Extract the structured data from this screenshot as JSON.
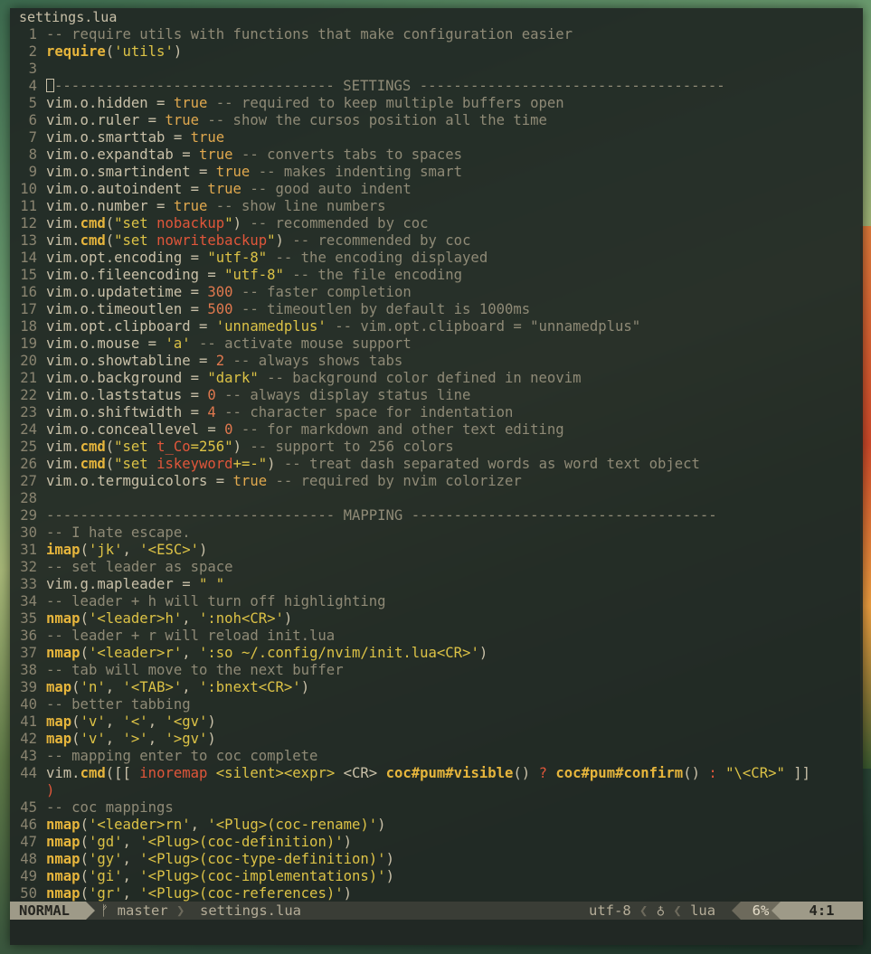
{
  "title": "settings.lua",
  "lines": [
    {
      "n": "1",
      "t": [
        [
          "c",
          "-- require utils with functions that make configuration easier"
        ]
      ]
    },
    {
      "n": "2",
      "t": [
        [
          "kw",
          "require"
        ],
        [
          "op",
          "("
        ],
        [
          "str",
          "'utils'"
        ],
        [
          "op",
          ")"
        ]
      ]
    },
    {
      "n": "3",
      "t": []
    },
    {
      "n": "4",
      "cursor": true,
      "t": [
        [
          "c",
          "---------------------------------- SETTINGS ------------------------------------"
        ]
      ]
    },
    {
      "n": "5",
      "t": [
        [
          "op",
          "vim.o.hidden = "
        ],
        [
          "bool",
          "true"
        ],
        [
          "c",
          " -- required to keep multiple buffers open"
        ]
      ]
    },
    {
      "n": "6",
      "t": [
        [
          "op",
          "vim.o.ruler = "
        ],
        [
          "bool",
          "true"
        ],
        [
          "c",
          " -- show the cursos position all the time"
        ]
      ]
    },
    {
      "n": "7",
      "t": [
        [
          "op",
          "vim.o.smarttab = "
        ],
        [
          "bool",
          "true"
        ]
      ]
    },
    {
      "n": "8",
      "t": [
        [
          "op",
          "vim.o.expandtab = "
        ],
        [
          "bool",
          "true"
        ],
        [
          "c",
          " -- converts tabs to spaces"
        ]
      ]
    },
    {
      "n": "9",
      "t": [
        [
          "op",
          "vim.o.smartindent = "
        ],
        [
          "bool",
          "true"
        ],
        [
          "c",
          " -- makes indenting smart"
        ]
      ]
    },
    {
      "n": "10",
      "t": [
        [
          "op",
          "vim.o.autoindent = "
        ],
        [
          "bool",
          "true"
        ],
        [
          "c",
          " -- good auto indent"
        ]
      ]
    },
    {
      "n": "11",
      "t": [
        [
          "op",
          "vim.o.number = "
        ],
        [
          "bool",
          "true"
        ],
        [
          "c",
          " -- show line numbers"
        ]
      ]
    },
    {
      "n": "12",
      "t": [
        [
          "op",
          "vim."
        ],
        [
          "kw",
          "cmd"
        ],
        [
          "op",
          "("
        ],
        [
          "str",
          "\"set "
        ],
        [
          "red",
          "nobackup"
        ],
        [
          "str",
          "\""
        ],
        [
          "op",
          ")"
        ],
        [
          "c",
          " -- recommended by coc"
        ]
      ]
    },
    {
      "n": "13",
      "t": [
        [
          "op",
          "vim."
        ],
        [
          "kw",
          "cmd"
        ],
        [
          "op",
          "("
        ],
        [
          "str",
          "\"set "
        ],
        [
          "red",
          "nowritebackup"
        ],
        [
          "str",
          "\""
        ],
        [
          "op",
          ")"
        ],
        [
          "c",
          " -- recommended by coc"
        ]
      ]
    },
    {
      "n": "14",
      "t": [
        [
          "op",
          "vim.opt.encoding = "
        ],
        [
          "str",
          "\"utf-8\""
        ],
        [
          "c",
          " -- the encoding displayed"
        ]
      ]
    },
    {
      "n": "15",
      "t": [
        [
          "op",
          "vim.o.fileencoding = "
        ],
        [
          "str",
          "\"utf-8\""
        ],
        [
          "c",
          " -- the file encoding"
        ]
      ]
    },
    {
      "n": "16",
      "t": [
        [
          "op",
          "vim.o.updatetime = "
        ],
        [
          "num",
          "300"
        ],
        [
          "c",
          " -- faster completion"
        ]
      ]
    },
    {
      "n": "17",
      "t": [
        [
          "op",
          "vim.o.timeoutlen = "
        ],
        [
          "num",
          "500"
        ],
        [
          "c",
          " -- timeoutlen by default is 1000ms"
        ]
      ]
    },
    {
      "n": "18",
      "t": [
        [
          "op",
          "vim.opt.clipboard = "
        ],
        [
          "str",
          "'unnamedplus'"
        ],
        [
          "c",
          " -- vim.opt.clipboard = \"unnamedplus\""
        ]
      ]
    },
    {
      "n": "19",
      "t": [
        [
          "op",
          "vim.o.mouse = "
        ],
        [
          "str",
          "'a'"
        ],
        [
          "c",
          " -- activate mouse support"
        ]
      ]
    },
    {
      "n": "20",
      "t": [
        [
          "op",
          "vim.o.showtabline = "
        ],
        [
          "num",
          "2"
        ],
        [
          "c",
          " -- always shows tabs"
        ]
      ]
    },
    {
      "n": "21",
      "t": [
        [
          "op",
          "vim.o.background = "
        ],
        [
          "str",
          "\"dark\""
        ],
        [
          "c",
          " -- background color defined in neovim"
        ]
      ]
    },
    {
      "n": "22",
      "t": [
        [
          "op",
          "vim.o.laststatus = "
        ],
        [
          "num",
          "0"
        ],
        [
          "c",
          " -- always display status line"
        ]
      ]
    },
    {
      "n": "23",
      "t": [
        [
          "op",
          "vim.o.shiftwidth = "
        ],
        [
          "num",
          "4"
        ],
        [
          "c",
          " -- character space for indentation"
        ]
      ]
    },
    {
      "n": "24",
      "t": [
        [
          "op",
          "vim.o.conceallevel = "
        ],
        [
          "num",
          "0"
        ],
        [
          "c",
          " -- for markdown and other text editing"
        ]
      ]
    },
    {
      "n": "25",
      "t": [
        [
          "op",
          "vim."
        ],
        [
          "kw",
          "cmd"
        ],
        [
          "op",
          "("
        ],
        [
          "str",
          "\"set "
        ],
        [
          "red",
          "t_Co"
        ],
        [
          "str",
          "=256\""
        ],
        [
          "op",
          ")"
        ],
        [
          "c",
          " -- support to 256 colors"
        ]
      ]
    },
    {
      "n": "26",
      "t": [
        [
          "op",
          "vim."
        ],
        [
          "kw",
          "cmd"
        ],
        [
          "op",
          "("
        ],
        [
          "str",
          "\"set "
        ],
        [
          "red",
          "iskeyword"
        ],
        [
          "str",
          "+=-\""
        ],
        [
          "op",
          ")"
        ],
        [
          "c",
          " -- treat dash separated words as word text object"
        ]
      ]
    },
    {
      "n": "27",
      "t": [
        [
          "op",
          "vim.o.termguicolors = "
        ],
        [
          "bool",
          "true"
        ],
        [
          "c",
          " -- required by nvim colorizer"
        ]
      ]
    },
    {
      "n": "28",
      "t": []
    },
    {
      "n": "29",
      "t": [
        [
          "c",
          "---------------------------------- MAPPING ------------------------------------"
        ]
      ]
    },
    {
      "n": "30",
      "t": [
        [
          "c",
          "-- I hate escape."
        ]
      ]
    },
    {
      "n": "31",
      "t": [
        [
          "kw",
          "imap"
        ],
        [
          "op",
          "("
        ],
        [
          "str",
          "'jk'"
        ],
        [
          "op",
          ", "
        ],
        [
          "str",
          "'<ESC>'"
        ],
        [
          "op",
          ")"
        ]
      ]
    },
    {
      "n": "32",
      "t": [
        [
          "c",
          "-- set leader as space"
        ]
      ]
    },
    {
      "n": "33",
      "t": [
        [
          "op",
          "vim.g.mapleader = "
        ],
        [
          "str",
          "\" \""
        ]
      ]
    },
    {
      "n": "34",
      "t": [
        [
          "c",
          "-- leader + h will turn off highlighting"
        ]
      ]
    },
    {
      "n": "35",
      "t": [
        [
          "kw",
          "nmap"
        ],
        [
          "op",
          "("
        ],
        [
          "str",
          "'<leader>h'"
        ],
        [
          "op",
          ", "
        ],
        [
          "str",
          "':noh<CR>'"
        ],
        [
          "op",
          ")"
        ]
      ]
    },
    {
      "n": "36",
      "t": [
        [
          "c",
          "-- leader + r will reload init.lua"
        ]
      ]
    },
    {
      "n": "37",
      "t": [
        [
          "kw",
          "nmap"
        ],
        [
          "op",
          "("
        ],
        [
          "str",
          "'<leader>r'"
        ],
        [
          "op",
          ", "
        ],
        [
          "str",
          "':so ~/.config/nvim/init.lua<CR>'"
        ],
        [
          "op",
          ")"
        ]
      ]
    },
    {
      "n": "38",
      "t": [
        [
          "c",
          "-- tab will move to the next buffer"
        ]
      ]
    },
    {
      "n": "39",
      "t": [
        [
          "kw",
          "map"
        ],
        [
          "op",
          "("
        ],
        [
          "str",
          "'n'"
        ],
        [
          "op",
          ", "
        ],
        [
          "str",
          "'<TAB>'"
        ],
        [
          "op",
          ", "
        ],
        [
          "str",
          "':bnext<CR>'"
        ],
        [
          "op",
          ")"
        ]
      ]
    },
    {
      "n": "40",
      "t": [
        [
          "c",
          "-- better tabbing"
        ]
      ]
    },
    {
      "n": "41",
      "t": [
        [
          "kw",
          "map"
        ],
        [
          "op",
          "("
        ],
        [
          "str",
          "'v'"
        ],
        [
          "op",
          ", "
        ],
        [
          "str",
          "'<'"
        ],
        [
          "op",
          ", "
        ],
        [
          "str",
          "'<gv'"
        ],
        [
          "op",
          ")"
        ]
      ]
    },
    {
      "n": "42",
      "t": [
        [
          "kw",
          "map"
        ],
        [
          "op",
          "("
        ],
        [
          "str",
          "'v'"
        ],
        [
          "op",
          ", "
        ],
        [
          "str",
          "'>'"
        ],
        [
          "op",
          ", "
        ],
        [
          "str",
          "'>gv'"
        ],
        [
          "op",
          ")"
        ]
      ]
    },
    {
      "n": "43",
      "t": [
        [
          "c",
          "-- mapping enter to coc complete"
        ]
      ]
    },
    {
      "n": "44",
      "t": [
        [
          "op",
          "vim."
        ],
        [
          "kw",
          "cmd"
        ],
        [
          "op",
          "([[ "
        ],
        [
          "red",
          "inoremap"
        ],
        [
          "op",
          " "
        ],
        [
          "str",
          "<silent><expr>"
        ],
        [
          "op",
          " <CR> "
        ],
        [
          "kw",
          "coc#pum#visible"
        ],
        [
          "op",
          "() "
        ],
        [
          "red",
          "?"
        ],
        [
          "op",
          " "
        ],
        [
          "kw",
          "coc#pum#confirm"
        ],
        [
          "op",
          "() "
        ],
        [
          "red",
          ":"
        ],
        [
          "op",
          " "
        ],
        [
          "str",
          "\"\\<CR>\""
        ],
        [
          "op",
          " ]]"
        ]
      ]
    },
    {
      "n": "",
      "wrap": true,
      "t": [
        [
          "red",
          ")"
        ]
      ]
    },
    {
      "n": "45",
      "t": [
        [
          "c",
          "-- coc mappings"
        ]
      ]
    },
    {
      "n": "46",
      "t": [
        [
          "kw",
          "nmap"
        ],
        [
          "op",
          "("
        ],
        [
          "str",
          "'<leader>rn'"
        ],
        [
          "op",
          ", "
        ],
        [
          "str",
          "'<Plug>(coc-rename)'"
        ],
        [
          "op",
          ")"
        ]
      ]
    },
    {
      "n": "47",
      "t": [
        [
          "kw",
          "nmap"
        ],
        [
          "op",
          "("
        ],
        [
          "str",
          "'gd'"
        ],
        [
          "op",
          ", "
        ],
        [
          "str",
          "'<Plug>(coc-definition)'"
        ],
        [
          "op",
          ")"
        ]
      ]
    },
    {
      "n": "48",
      "t": [
        [
          "kw",
          "nmap"
        ],
        [
          "op",
          "("
        ],
        [
          "str",
          "'gy'"
        ],
        [
          "op",
          ", "
        ],
        [
          "str",
          "'<Plug>(coc-type-definition)'"
        ],
        [
          "op",
          ")"
        ]
      ]
    },
    {
      "n": "49",
      "t": [
        [
          "kw",
          "nmap"
        ],
        [
          "op",
          "("
        ],
        [
          "str",
          "'gi'"
        ],
        [
          "op",
          ", "
        ],
        [
          "str",
          "'<Plug>(coc-implementations)'"
        ],
        [
          "op",
          ")"
        ]
      ]
    },
    {
      "n": "50",
      "t": [
        [
          "kw",
          "nmap"
        ],
        [
          "op",
          "("
        ],
        [
          "str",
          "'gr'"
        ],
        [
          "op",
          ", "
        ],
        [
          "str",
          "'<Plug>(coc-references)'"
        ],
        [
          "op",
          ")"
        ]
      ]
    }
  ],
  "statusline": {
    "mode": "NORMAL",
    "branch_icon": "ᚠ",
    "branch": "master",
    "filename": "settings.lua",
    "encoding": "utf-8",
    "fileformat_icon": "♁",
    "filetype": "lua",
    "percent": "6%",
    "position": "4:1"
  },
  "colors": {
    "comment": "#8f8a76",
    "keyword": "#e6b53c",
    "string": "#dcc246",
    "number": "#e0784e",
    "red": "#e0563a",
    "text": "#c9c0a8"
  }
}
